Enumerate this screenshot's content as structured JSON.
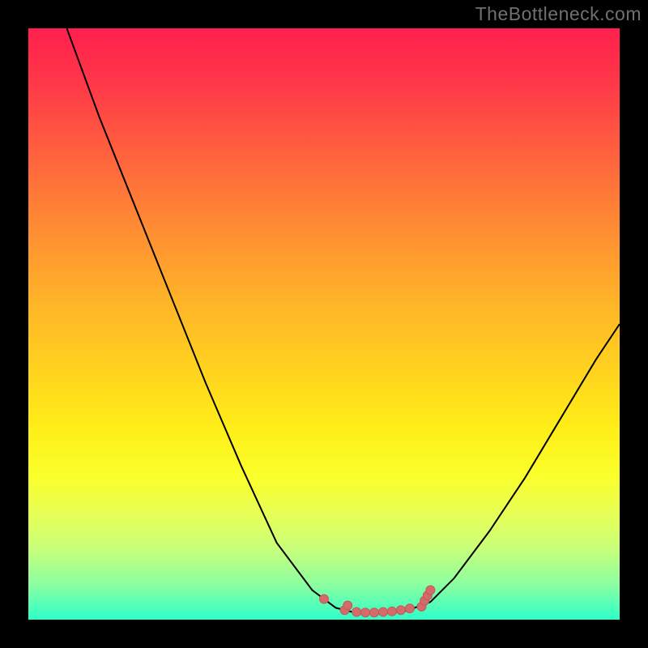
{
  "watermark": "TheBottleneck.com",
  "colors": {
    "background": "#000000",
    "watermark_text": "#707070",
    "curve_stroke": "#000000",
    "marker_fill": "#d46a6a",
    "marker_stroke": "#c85858"
  },
  "chart_data": {
    "type": "line",
    "title": "",
    "xlabel": "",
    "ylabel": "",
    "xlim": [
      0,
      100
    ],
    "ylim": [
      0,
      100
    ],
    "grid": false,
    "curve": [
      {
        "x": 6.5,
        "y": 100
      },
      {
        "x": 12,
        "y": 85
      },
      {
        "x": 18,
        "y": 70
      },
      {
        "x": 24,
        "y": 55
      },
      {
        "x": 30,
        "y": 40
      },
      {
        "x": 36,
        "y": 26
      },
      {
        "x": 42,
        "y": 13
      },
      {
        "x": 48,
        "y": 5
      },
      {
        "x": 52,
        "y": 2
      },
      {
        "x": 56,
        "y": 1
      },
      {
        "x": 60,
        "y": 1
      },
      {
        "x": 64,
        "y": 1.5
      },
      {
        "x": 68,
        "y": 3
      },
      {
        "x": 72,
        "y": 7
      },
      {
        "x": 78,
        "y": 15
      },
      {
        "x": 84,
        "y": 24
      },
      {
        "x": 90,
        "y": 34
      },
      {
        "x": 96,
        "y": 44
      },
      {
        "x": 100,
        "y": 50
      }
    ],
    "markers": [
      {
        "x": 50,
        "y": 3.5
      },
      {
        "x": 53.5,
        "y": 1.6
      },
      {
        "x": 54,
        "y": 2.4
      },
      {
        "x": 55.5,
        "y": 1.3
      },
      {
        "x": 57,
        "y": 1.2
      },
      {
        "x": 58.5,
        "y": 1.2
      },
      {
        "x": 60,
        "y": 1.3
      },
      {
        "x": 61.5,
        "y": 1.4
      },
      {
        "x": 63,
        "y": 1.6
      },
      {
        "x": 64.5,
        "y": 1.9
      },
      {
        "x": 66.5,
        "y": 2.2
      },
      {
        "x": 67,
        "y": 3.2
      },
      {
        "x": 67.5,
        "y": 4.1
      },
      {
        "x": 68,
        "y": 5.0
      }
    ]
  }
}
